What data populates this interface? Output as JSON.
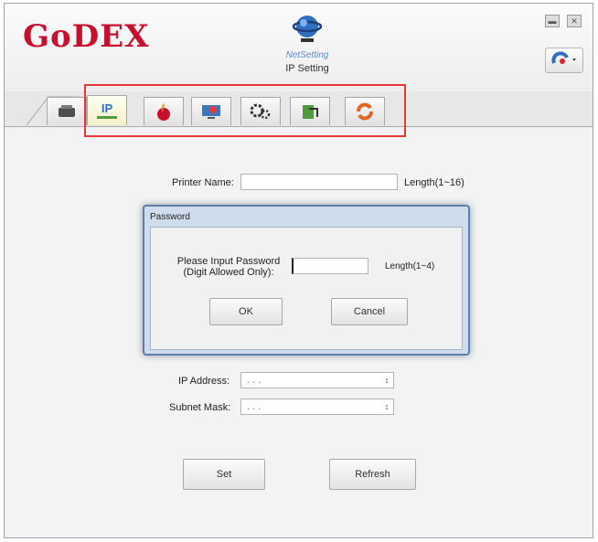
{
  "header": {
    "brand_logo": "GoDEX",
    "app_brand": "NetSetting",
    "app_subtitle": "IP Setting",
    "minimize_glyph": "▬",
    "close_glyph": "✕"
  },
  "tabs": [
    {
      "icon": "printer-icon"
    },
    {
      "icon": "ip-icon",
      "label": "IP",
      "active": true
    },
    {
      "icon": "fire-icon"
    },
    {
      "icon": "monitor-alert-icon"
    },
    {
      "icon": "gears-icon"
    },
    {
      "icon": "export-icon"
    },
    {
      "icon": "refresh-arrows-icon"
    }
  ],
  "form": {
    "printer_name_label": "Printer Name:",
    "printer_name_value": "",
    "printer_name_hint": "Length(1~16)",
    "ip_address_label": "IP Address:",
    "ip_address_value": ".   .   .",
    "subnet_mask_label": "Subnet Mask:",
    "subnet_mask_value": ".   .   .",
    "set_button": "Set",
    "refresh_button": "Refresh"
  },
  "password_dialog": {
    "title": "Password",
    "prompt_line1": "Please Input Password",
    "prompt_line2": "(Digit Allowed Only):",
    "password_value": "",
    "hint": "Length(1~4)",
    "ok_button": "OK",
    "cancel_button": "Cancel"
  },
  "colors": {
    "brand_red": "#c8102e",
    "highlight": "#e53935",
    "dialog_border": "#5f7fa6"
  }
}
